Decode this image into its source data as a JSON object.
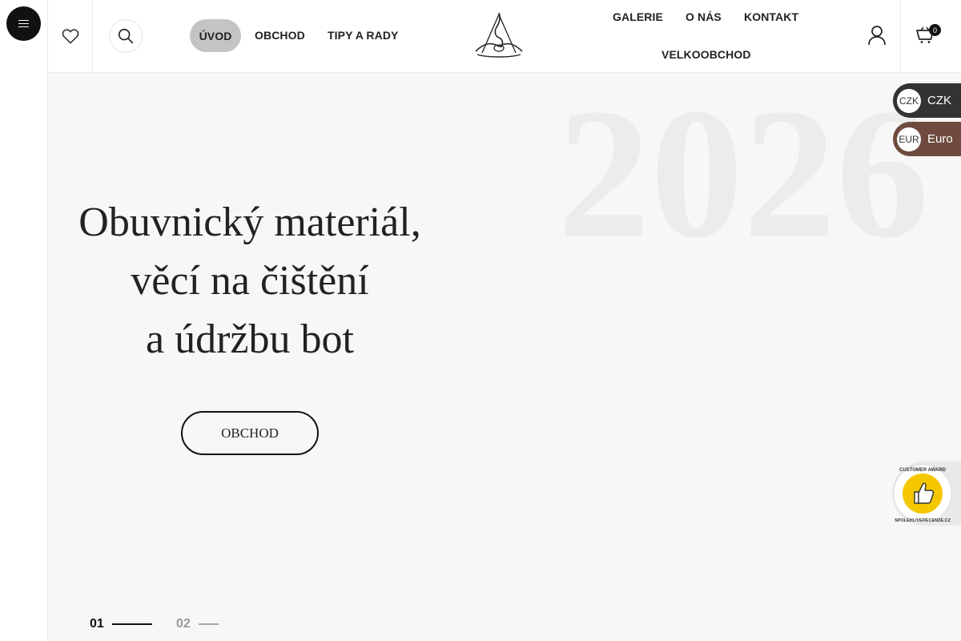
{
  "header": {
    "nav_left": [
      "ÚVOD",
      "OBCHOD",
      "TIPY A RADY"
    ],
    "nav_right": [
      "GALERIE",
      "O NÁS",
      "KONTAKT",
      "VELKOOBCHOD"
    ],
    "cart_count": "0"
  },
  "hero": {
    "year": "2026",
    "headline": [
      "Obuvnický materiál,",
      "věcí na čištění",
      "a údržbu bot"
    ],
    "cta_label": "OBCHOD",
    "slides": [
      "01",
      "02"
    ]
  },
  "currency": [
    {
      "code": "CZK",
      "name": "CZK"
    },
    {
      "code": "EUR",
      "name": "Euro"
    }
  ],
  "award_badge": {
    "text": "CUSTOMER AWARD SPOLEHLIVERECENZE.CZ"
  },
  "colors": {
    "accent_dark": "#111111",
    "active_nav_bg": "#c4c4c4",
    "eur_pill": "#6e4b3e",
    "czk_pill": "#333333"
  },
  "icons": [
    "menu-icon",
    "heart-icon",
    "search-icon",
    "logo",
    "user-icon",
    "cart-icon",
    "thumbs-up-icon"
  ]
}
